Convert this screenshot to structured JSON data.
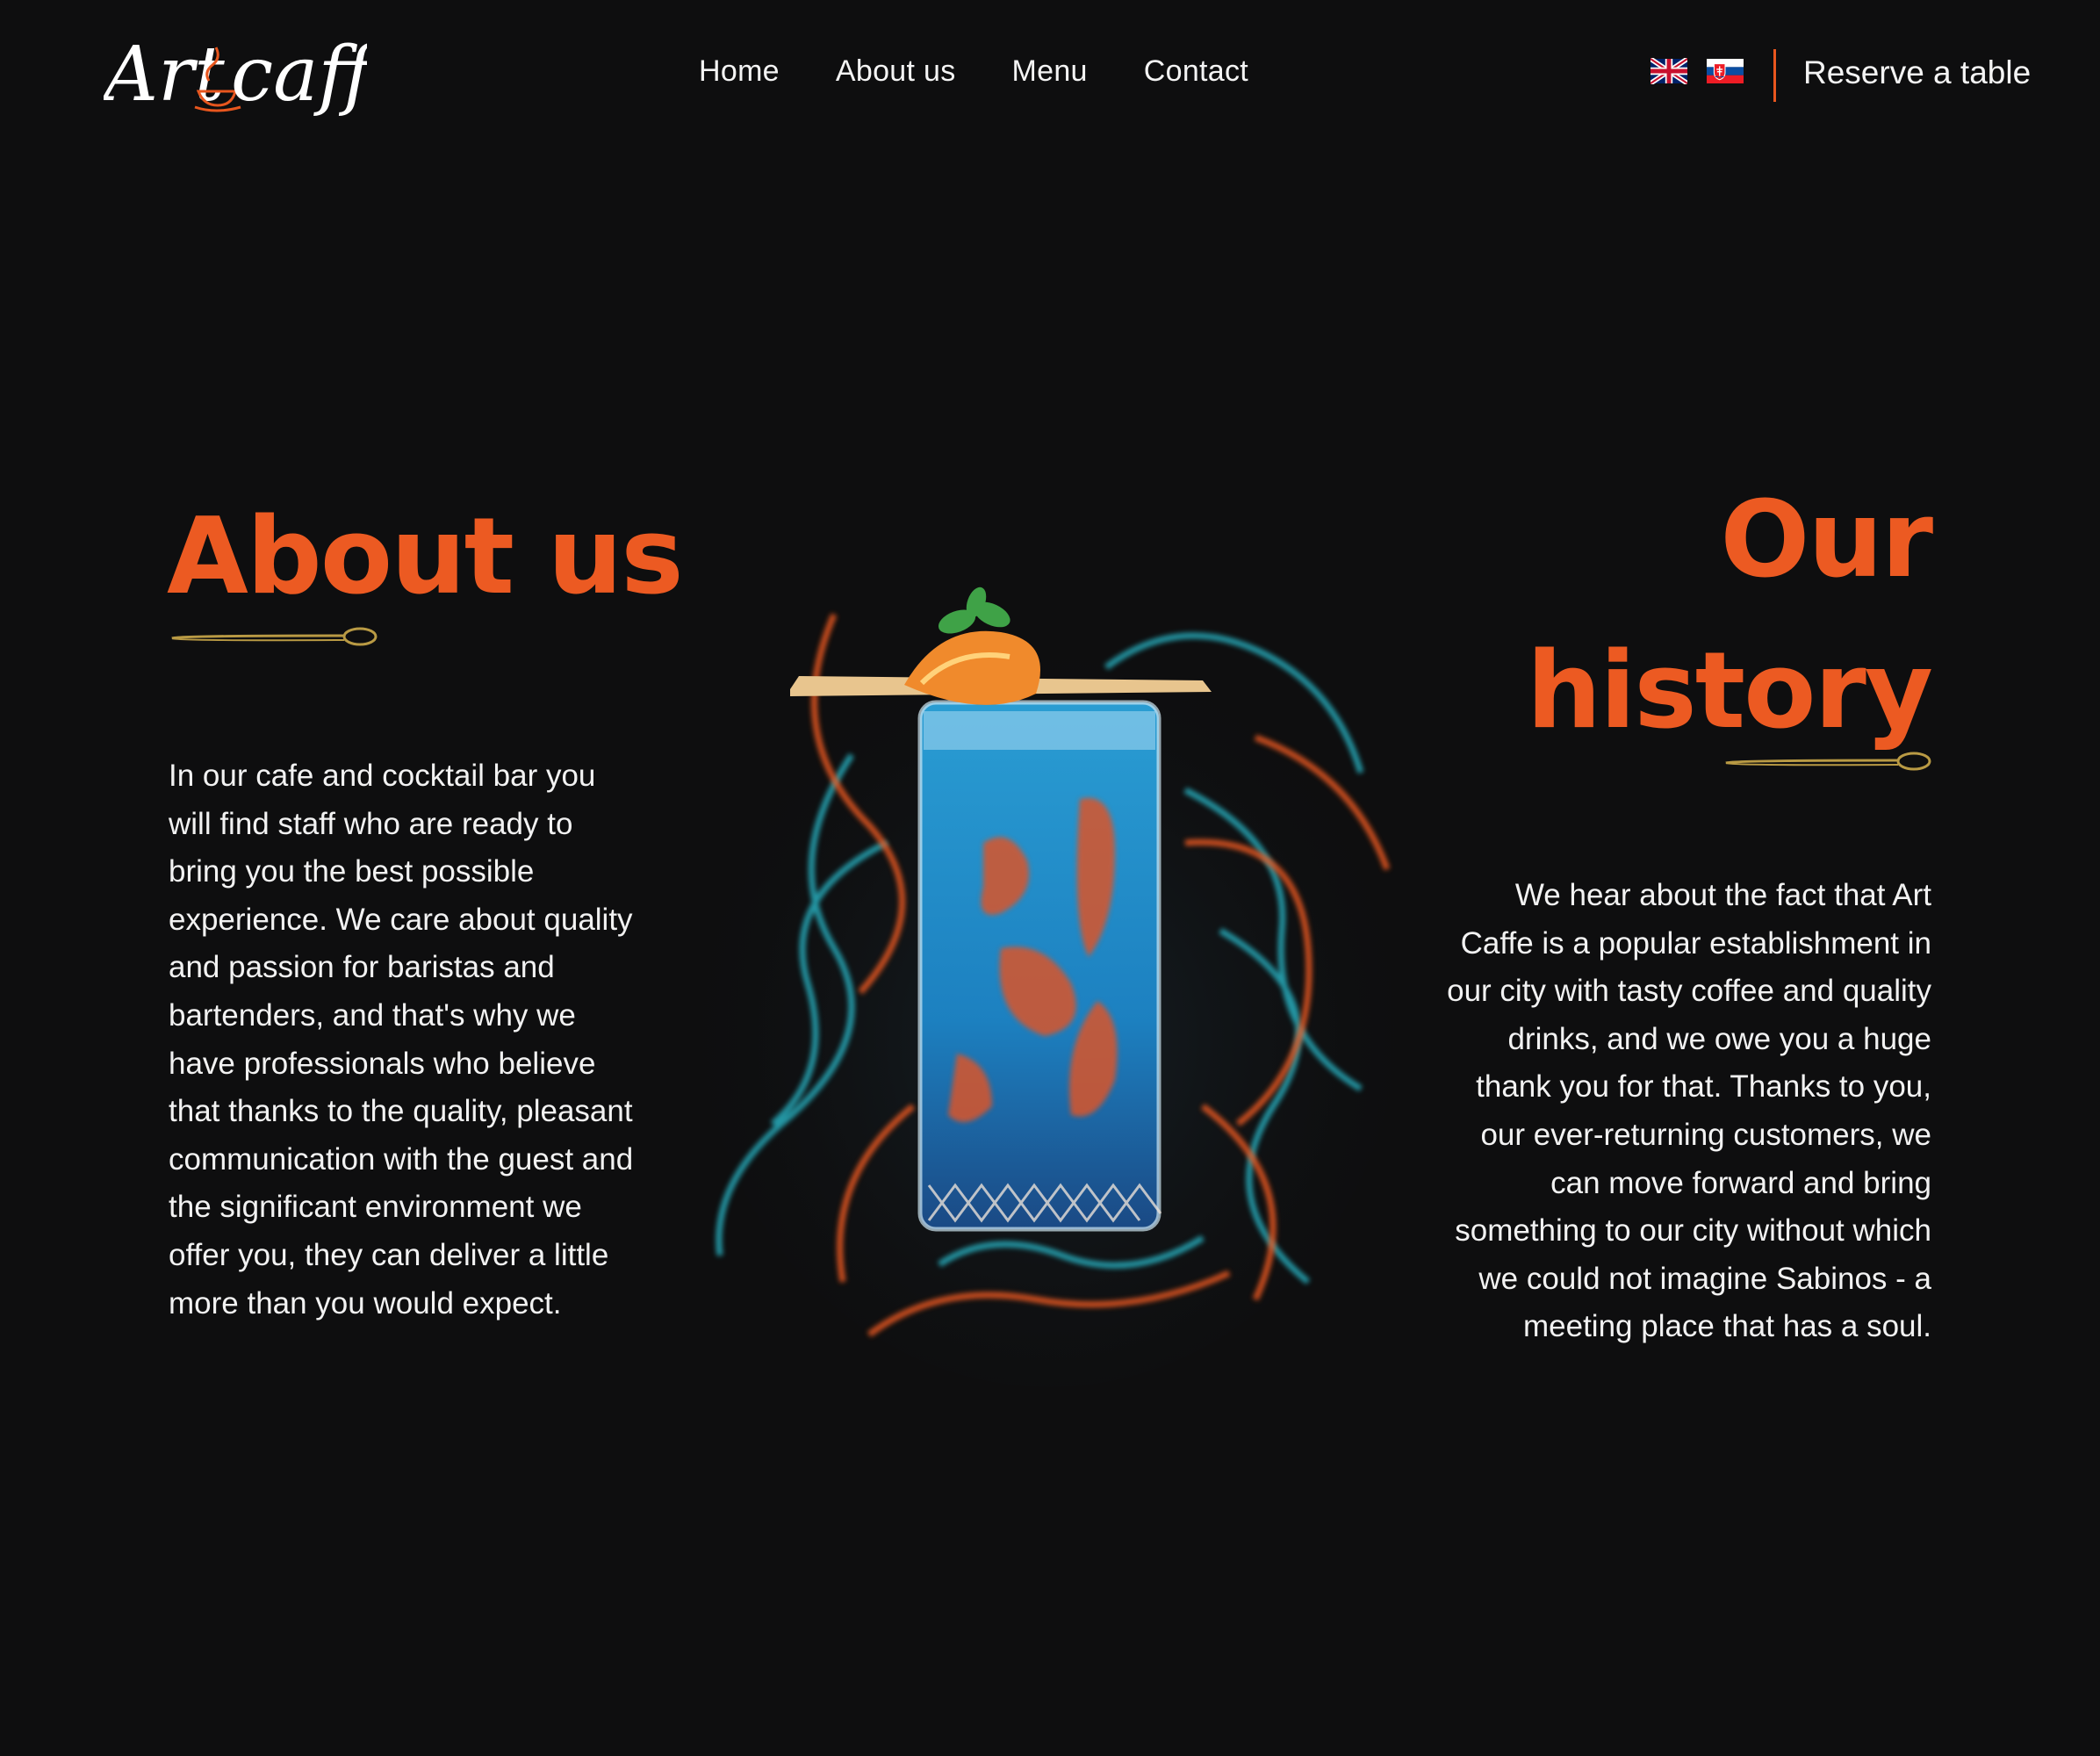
{
  "header": {
    "logo": {
      "part1": "Art",
      "part2": "caffe"
    },
    "nav": [
      "Home",
      "About us",
      "Menu",
      "Contact"
    ],
    "languages": [
      {
        "icon": "uk-flag-icon",
        "label": "English"
      },
      {
        "icon": "sk-flag-icon",
        "label": "Slovak"
      }
    ],
    "reserve_label": "Reserve a table"
  },
  "about": {
    "title": "About us",
    "text": "In our cafe and cocktail bar you will find staff who are ready to bring you the best possible experience. We care about quality and passion for baristas and bartenders, and that's why we have professionals who believe that thanks to the quality, pleasant communication with the guest and the significant environment we offer you, they can deliver a little more than you would expect."
  },
  "history": {
    "title_line1": "Our",
    "title_line2": "history",
    "text": "We hear about the fact that Art Caffe is a popular establishment in our city with tasty coffee and quality drinks, and we owe you a huge thank you for that. Thanks to you, our ever-returning customers, we can move forward and bring something to our city without which we could not imagine Sabinos - a meeting place that has a soul."
  },
  "colors": {
    "background": "#0e0e0f",
    "accent": "#ec5a22",
    "text": "#f2f2f2",
    "spoon": "#b99a44"
  }
}
